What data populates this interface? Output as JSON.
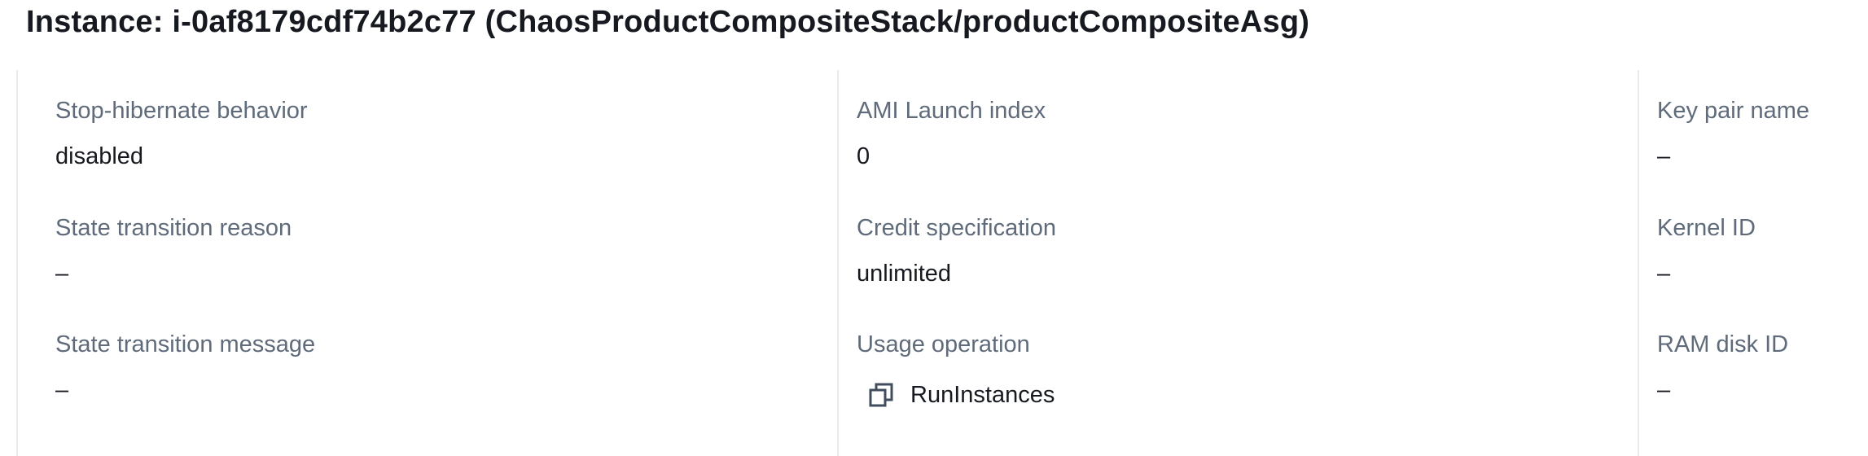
{
  "header": {
    "title": "Instance: i-0af8179cdf74b2c77 (ChaosProductCompositeStack/productCompositeAsg)"
  },
  "details": {
    "col1": [
      {
        "label": "Stop-hibernate behavior",
        "value": "disabled"
      },
      {
        "label": "State transition reason",
        "value": "–"
      },
      {
        "label": "State transition message",
        "value": "–"
      }
    ],
    "col2": [
      {
        "label": "AMI Launch index",
        "value": "0"
      },
      {
        "label": "Credit specification",
        "value": "unlimited"
      },
      {
        "label": "Usage operation",
        "value": "RunInstances",
        "icon": "copy-icon"
      }
    ],
    "col3": [
      {
        "label": "Key pair name",
        "value": "–"
      },
      {
        "label": "Kernel ID",
        "value": "–"
      },
      {
        "label": "RAM disk ID",
        "value": "–"
      }
    ]
  }
}
